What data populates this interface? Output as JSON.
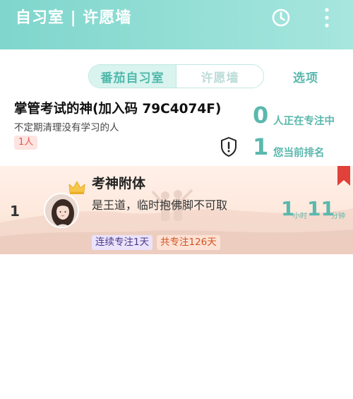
{
  "header": {
    "title": "自习室 | 许愿墙",
    "clock_icon": "clock-icon",
    "more_icon": "more-vertical-icon",
    "accent_color": "#7fd6cc"
  },
  "tabs": [
    {
      "label": "番茄自习室",
      "active": true
    },
    {
      "label": "许愿墙",
      "active": false
    }
  ],
  "options_label": "选项",
  "room": {
    "name": "掌管考试的神(加入码 79C4074F)",
    "description": "不定期清理没有学习的人",
    "member_count": "1人",
    "focusing_count": "0",
    "focusing_label": "人正在专注中",
    "rank_number": "1",
    "rank_label": "您当前排名"
  },
  "ranking": [
    {
      "rank": "1",
      "name": "考神附体",
      "motto": "是王道，临时抱佛脚不可取",
      "streak_tag": "连续专注1天",
      "total_tag": "共专注126天",
      "hours": "1",
      "hours_unit": "小时",
      "minutes": "11",
      "minutes_unit": "分钟"
    }
  ],
  "colors": {
    "teal": "#5bb8ad",
    "badge_red": "#e25b4f",
    "bookmark_red": "#e0413a"
  }
}
